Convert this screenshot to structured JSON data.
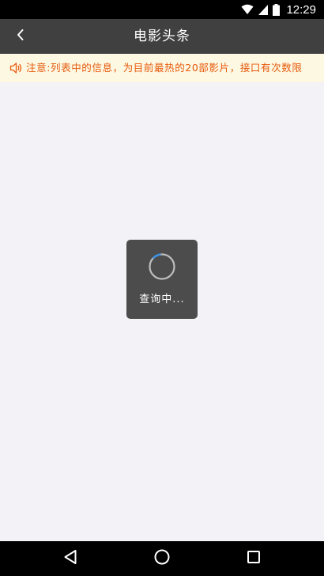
{
  "status_bar": {
    "time": "12:29",
    "icons": [
      "wifi-icon",
      "cell-signal-icon",
      "battery-icon"
    ]
  },
  "header": {
    "title": "电影头条",
    "back_icon": "chevron-left-icon"
  },
  "notice": {
    "icon": "speaker-icon",
    "text": "注意:列表中的信息，为目前最热的20部影片，接口有次数限"
  },
  "loading": {
    "text": "查询中..."
  },
  "nav_bar": {
    "icons": [
      "nav-back-icon",
      "nav-home-icon",
      "nav-recents-icon"
    ]
  },
  "colors": {
    "status_bar_bg": "#000000",
    "app_bar_bg": "#404040",
    "notice_bg": "#fdf8e2",
    "notice_text": "#e8590c",
    "page_bg": "#f2f2f7",
    "toast_bg": "#4c4c4c",
    "spinner_accent": "#3d8fe0"
  }
}
